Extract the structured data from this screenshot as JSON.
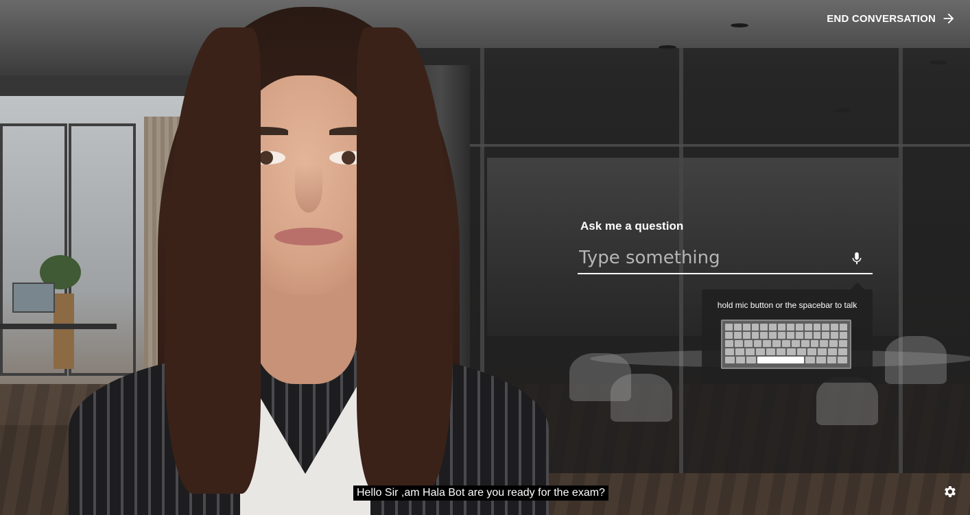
{
  "header": {
    "end_conversation_label": "END CONVERSATION",
    "end_icon": "arrow-right-icon"
  },
  "ask": {
    "label": "Ask me a question",
    "placeholder": "Type something",
    "value": "",
    "mic_icon": "mic-icon"
  },
  "hint": {
    "text": "hold mic button or the spacebar to talk",
    "illustration": "keyboard-icon"
  },
  "subtitle": {
    "text": "Hello Sir ,am Hala Bot are you ready for the exam?"
  },
  "footer": {
    "settings_icon": "gear-icon"
  },
  "colors": {
    "text": "#ffffff",
    "subtitle_bg": "#000000",
    "hint_bg": "#202020",
    "placeholder": "#b5b5b5"
  }
}
